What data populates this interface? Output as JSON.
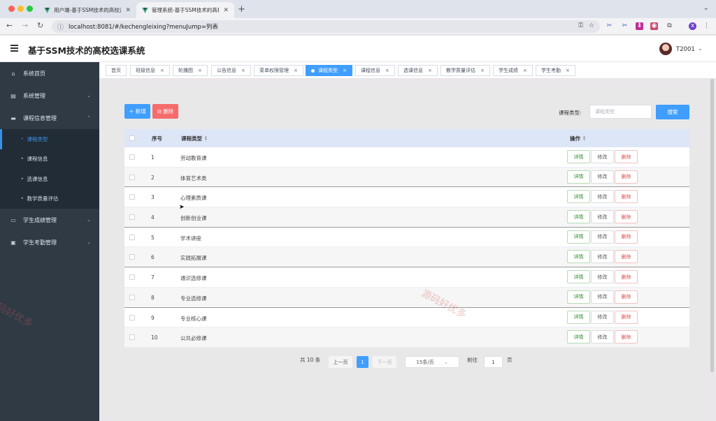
{
  "browser": {
    "tabs": [
      {
        "title": "用户端-基于SSM技术的高校选",
        "active": false
      },
      {
        "title": "管理系统-基于SSM技术的高校",
        "active": true
      }
    ],
    "url": "localhost:8081/#/kechengleixing?menuJump=列表",
    "profile_initial": "x"
  },
  "app": {
    "title": "基于SSM技术的高校选课系统",
    "user": "T2001"
  },
  "sidebar": {
    "items": [
      {
        "label": "系统首页",
        "icon": "home-icon"
      },
      {
        "label": "系统管理",
        "icon": "system-icon"
      },
      {
        "label": "课程信息管理",
        "icon": "course-icon"
      },
      {
        "label": "学生成绩管理",
        "icon": "grade-icon"
      },
      {
        "label": "学生考勤管理",
        "icon": "attendance-icon"
      }
    ],
    "subitems": [
      {
        "label": "课程类型"
      },
      {
        "label": "课程信息"
      },
      {
        "label": "选课信息"
      },
      {
        "label": "教学质量评估"
      }
    ]
  },
  "tags": [
    {
      "label": "首页"
    },
    {
      "label": "班级信息"
    },
    {
      "label": "轮播图"
    },
    {
      "label": "公告信息"
    },
    {
      "label": "菜单权限管理"
    },
    {
      "label": "课程类型"
    },
    {
      "label": "课程信息"
    },
    {
      "label": "选课信息"
    },
    {
      "label": "教学质量评估"
    },
    {
      "label": "学生成绩"
    },
    {
      "label": "学生考勤"
    }
  ],
  "toolbar": {
    "add_label": "新增",
    "delete_label": "删除",
    "search_label": "课程类型:",
    "search_placeholder": "课程类型",
    "search_button": "搜索"
  },
  "table": {
    "headers": {
      "index": "序号",
      "type": "课程类型",
      "actions": "操作"
    },
    "action_labels": {
      "detail": "详情",
      "edit": "修改",
      "delete": "删除"
    },
    "rows": [
      {
        "index": "1",
        "type": "劳动教育课"
      },
      {
        "index": "2",
        "type": "体育艺术类"
      },
      {
        "index": "3",
        "type": "心理素质课"
      },
      {
        "index": "4",
        "type": "创新创业课"
      },
      {
        "index": "5",
        "type": "学术讲座"
      },
      {
        "index": "6",
        "type": "实践拓展课"
      },
      {
        "index": "7",
        "type": "通识选修课"
      },
      {
        "index": "8",
        "type": "专业选修课"
      },
      {
        "index": "9",
        "type": "专业核心课"
      },
      {
        "index": "10",
        "type": "公共必修课"
      }
    ]
  },
  "pagination": {
    "total": "共 10 条",
    "prev": "上一页",
    "current_page": "1",
    "next": "下一页",
    "page_size": "15条/页",
    "goto_prefix": "前往",
    "goto_value": "1",
    "goto_suffix": "页"
  },
  "watermark": "源码好优多",
  "colors": {
    "primary": "#409eff",
    "danger": "#f56c6c",
    "sidebar_bg": "#2f3a45",
    "header_row_bg": "#dde6f7"
  }
}
